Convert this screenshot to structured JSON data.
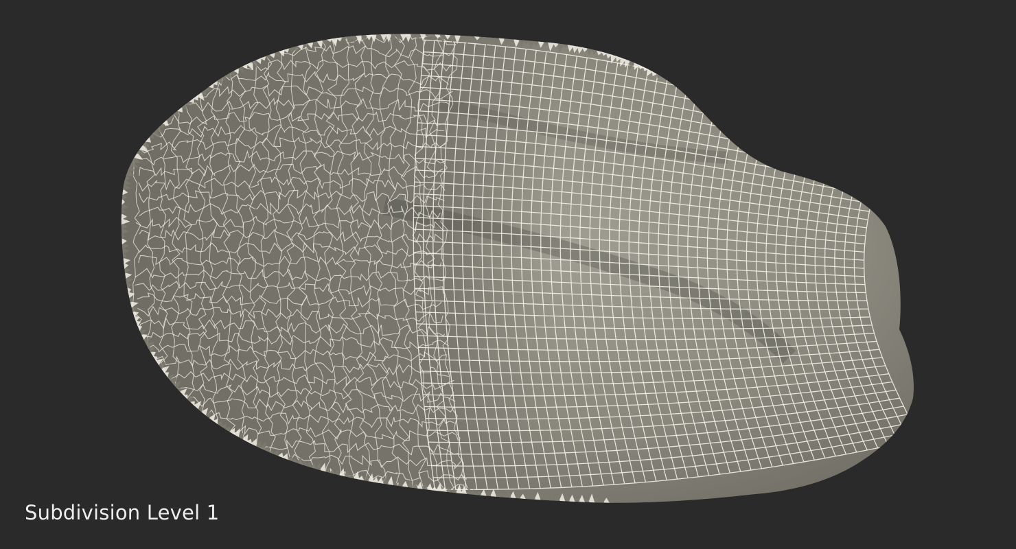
{
  "render": {
    "caption": "Subdivision Level 1",
    "background_color": "#2a2a2a",
    "surface_color": "#8e8c80",
    "rough_surface_color": "#7c7a70",
    "shadow_color": "#4e4d47",
    "wire_color": "#f2f0e6",
    "caption_color": "#eeeeee"
  }
}
